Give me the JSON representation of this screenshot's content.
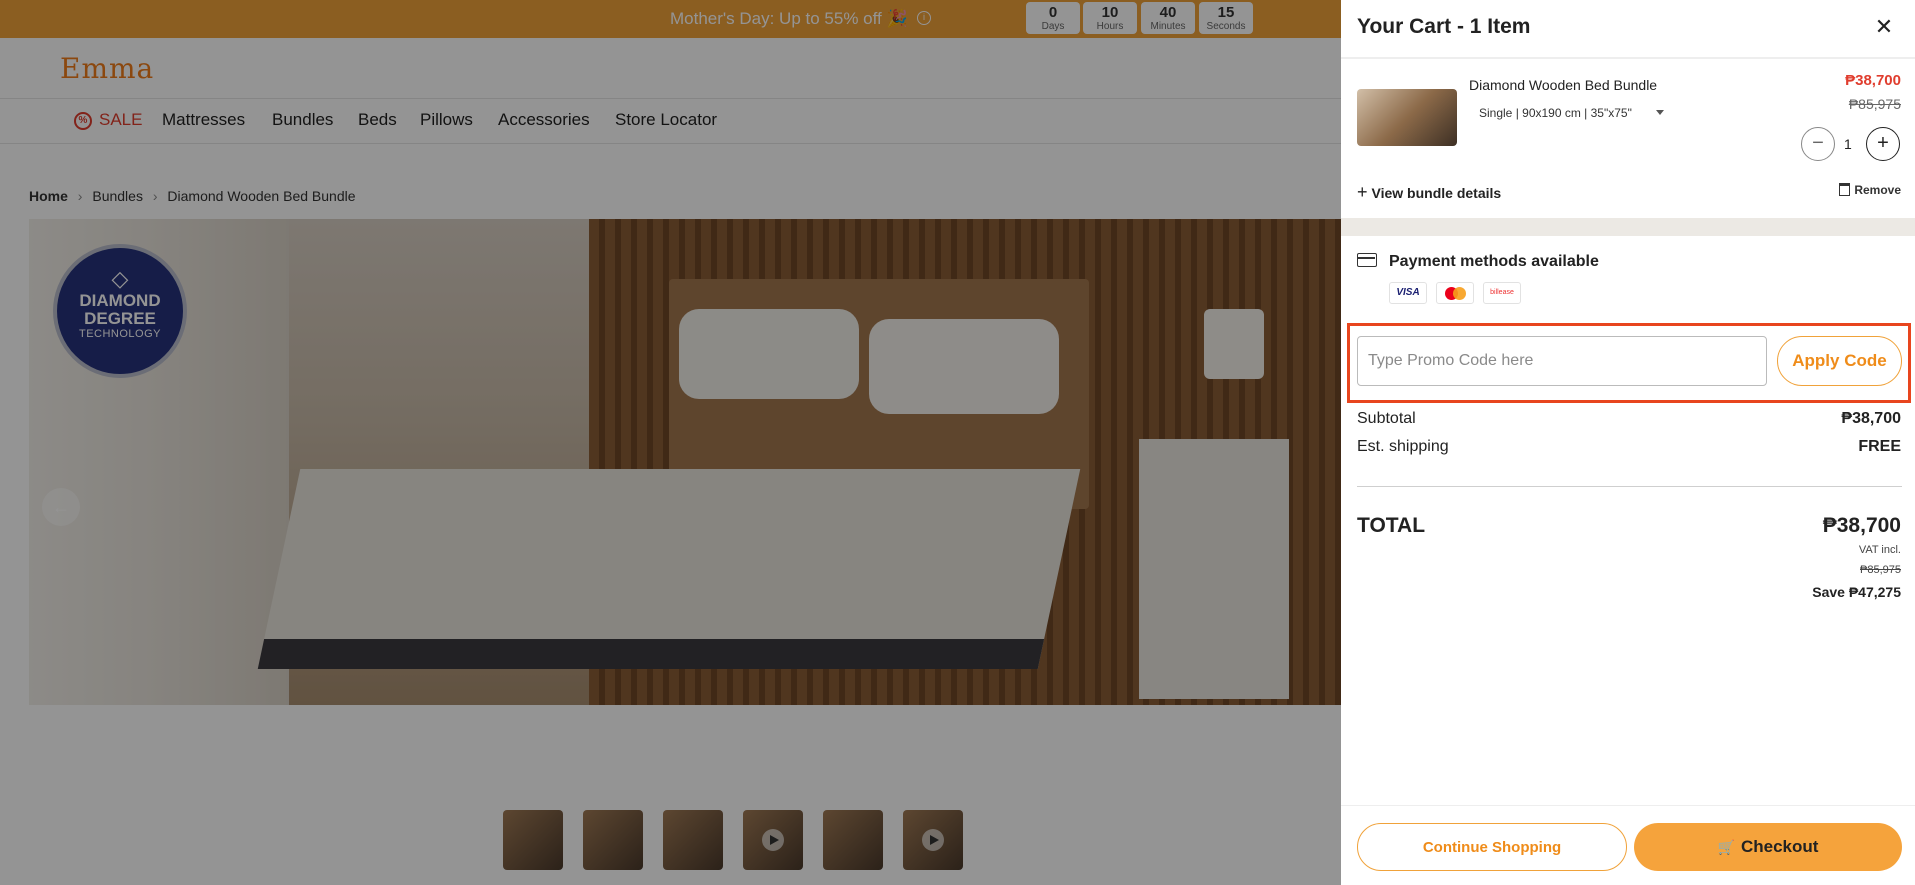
{
  "promo_bar": {
    "text": "Mother's Day: Up to 55% off 🎉",
    "info_icon": "info-icon",
    "countdown": [
      {
        "value": "0",
        "label": "Days"
      },
      {
        "value": "10",
        "label": "Hours"
      },
      {
        "value": "40",
        "label": "Minutes"
      },
      {
        "value": "15",
        "label": "Seconds"
      }
    ]
  },
  "header": {
    "logo": "Emma",
    "nav": [
      "SALE",
      "Mattresses",
      "Bundles",
      "Beds",
      "Pillows",
      "Accessories",
      "Store Locator"
    ]
  },
  "breadcrumb": [
    "Home",
    "Bundles",
    "Diamond Wooden Bed Bundle"
  ],
  "hero": {
    "badge_line1": "DIAMOND",
    "badge_line2": "DEGREE",
    "badge_line3": "TECHNOLOGY"
  },
  "cart": {
    "title": "Your Cart - 1 Item",
    "item": {
      "name": "Diamond Wooden Bed Bundle",
      "variant": "Single | 90x190 cm | 35\"x75\"",
      "price": "₱38,700",
      "original_price": "₱85,975",
      "quantity": "1"
    },
    "view_bundle": "View bundle details",
    "remove": "Remove",
    "payment_title": "Payment methods available",
    "payment_logos": [
      "VISA",
      "Mastercard",
      "billease"
    ],
    "promo_placeholder": "Type Promo Code here",
    "promo_value": "",
    "apply_label": "Apply Code",
    "subtotal_label": "Subtotal",
    "subtotal_value": "₱38,700",
    "shipping_label": "Est. shipping",
    "shipping_value": "FREE",
    "total_label": "TOTAL",
    "total_value": "₱38,700",
    "vat_note": "VAT incl.",
    "total_original": "₱85,975",
    "savings": "Save ₱47,275",
    "continue_label": "Continue Shopping",
    "checkout_label": "Checkout"
  },
  "colors": {
    "accent": "#f0a23a",
    "sale_red": "#e03d2e",
    "highlight": "#e8451e",
    "badge_blue": "#27337d"
  }
}
